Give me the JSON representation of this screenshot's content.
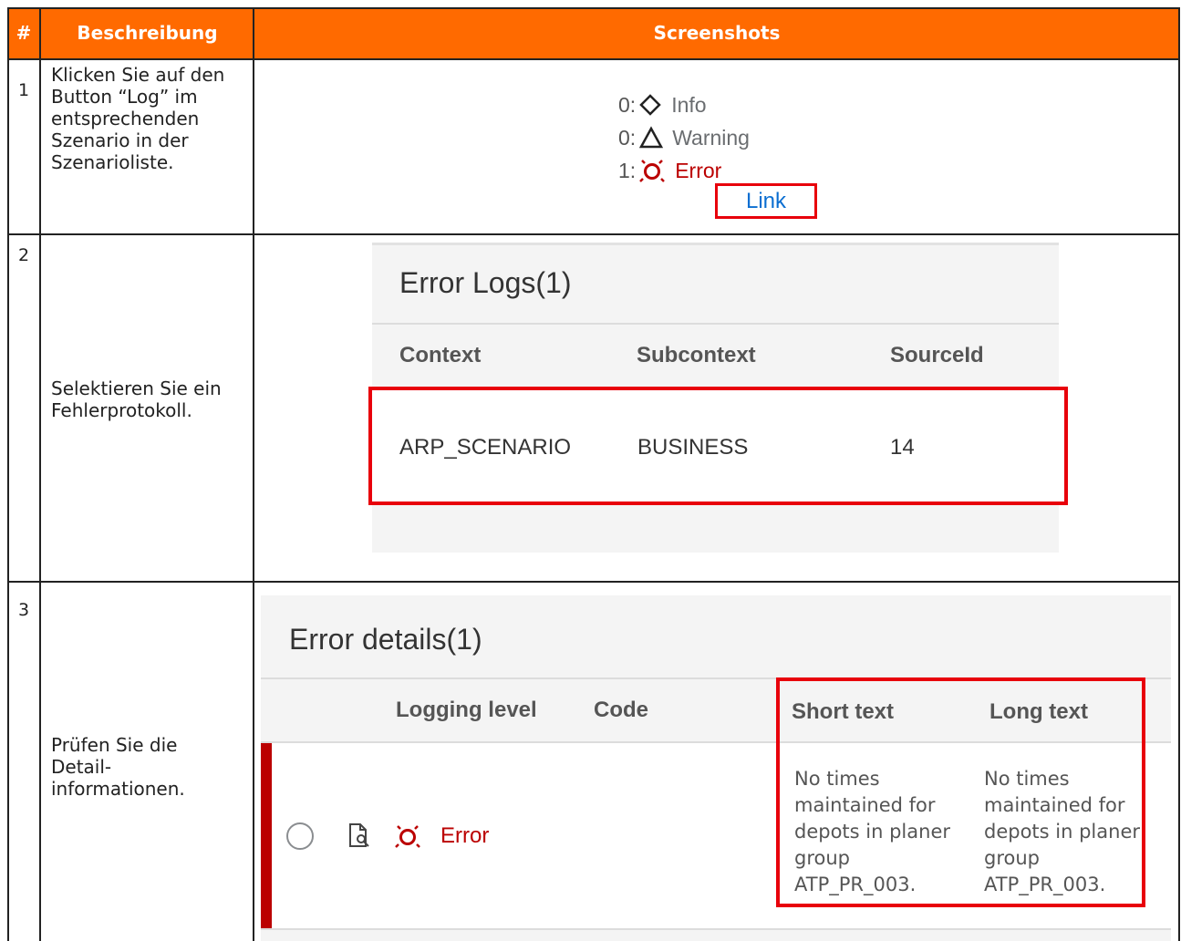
{
  "header": {
    "col_num": "#",
    "col_desc": "Beschreibung",
    "col_screens": "Screenshots"
  },
  "rows": [
    {
      "num": "1",
      "desc": "Klicken Sie auf den Button “Log” im entsprechenden Szenario in der Szenarioliste.",
      "legend": {
        "info_count": "0:",
        "info_label": "Info",
        "warning_count": "0:",
        "warning_label": "Warning",
        "error_count": "1:",
        "error_label": "Error",
        "link_label": "Link"
      }
    },
    {
      "num": "2",
      "desc": "Selektieren Sie ein Fehlerprotokoll.",
      "panel": {
        "title": "Error Logs(1)",
        "columns": [
          "Context",
          "Subcontext",
          "SourceId"
        ],
        "row": [
          "ARP_SCENARIO",
          "BUSINESS",
          "14"
        ]
      }
    },
    {
      "num": "3",
      "desc": "Prüfen Sie die Detail-informationen.",
      "panel": {
        "title": "Error details(1)",
        "columns": [
          "Logging level",
          "Code",
          "Short text",
          "Long text"
        ],
        "level_label": "Error",
        "short_text": "No times maintained for depots in planer group ATP_PR_003.",
        "long_text": "No times maintained for depots in planer group ATP_PR_003."
      }
    }
  ],
  "colors": {
    "header_bg": "#ff6a00",
    "highlight_border": "#e8000b",
    "error_red": "#bb0000",
    "link_blue": "#0a6ed1"
  }
}
